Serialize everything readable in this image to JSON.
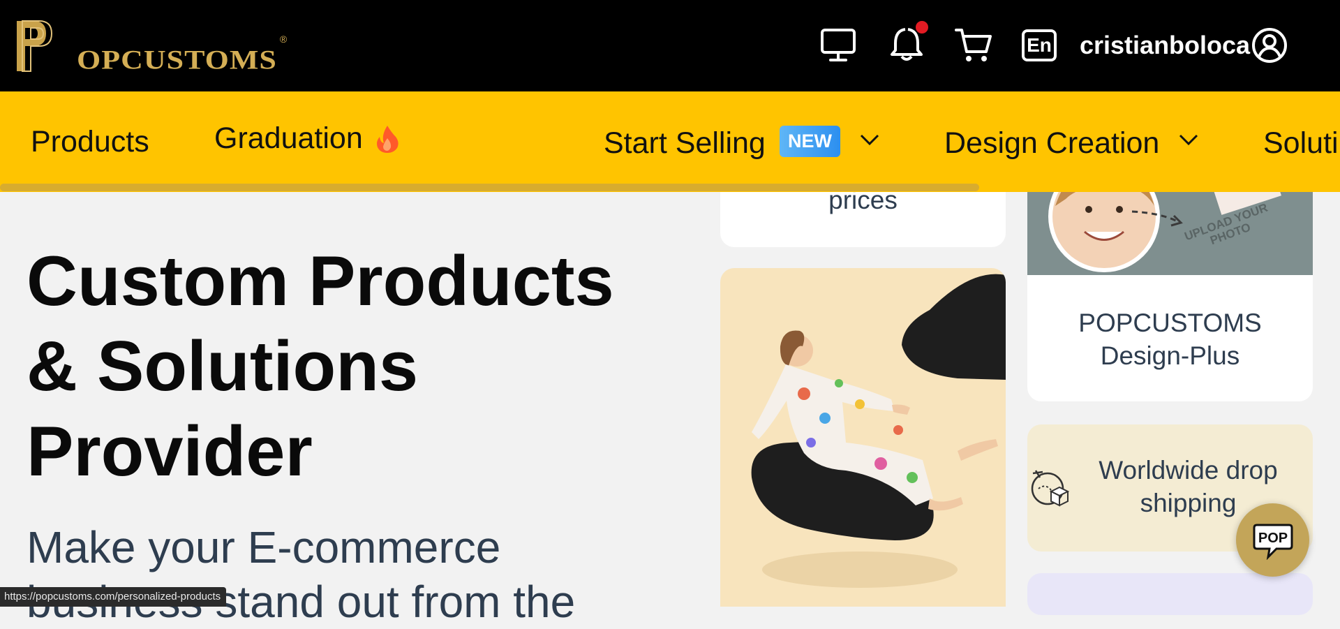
{
  "brand": {
    "logo_text": "OPCUSTOMS",
    "logo_mark": "PP",
    "registered": "®",
    "logo_color": "#d4ae55"
  },
  "header": {
    "icons": [
      "monitor-icon",
      "bell-icon",
      "cart-icon",
      "language-icon",
      "user-icon"
    ],
    "language": "En",
    "username": "cristianboloca",
    "notification_dot_color": "#e31b23"
  },
  "nav": {
    "items": [
      {
        "label": "Products"
      },
      {
        "label": "Graduation"
      },
      {
        "label": "Start Selling",
        "badge": "NEW"
      },
      {
        "label": "Design Creation"
      },
      {
        "label": "Soluti"
      }
    ],
    "background": "#ffc400"
  },
  "hero": {
    "title_line1": "Custom Products",
    "title_line2": "& Solutions",
    "title_line3": "Provider",
    "subtitle_line1": "Make your E-commerce",
    "subtitle_line2": "business stand out from the"
  },
  "cards": {
    "prices_text": "prices",
    "upload_caption": "UPLOAD YOUR PHOTO",
    "design_plus_line1": "POPCUSTOMS",
    "design_plus_line2": "Design-Plus",
    "dropship_line1": "Worldwide drop",
    "dropship_line2": "shipping"
  },
  "chat": {
    "label": "POP"
  },
  "status_url": "https://popcustoms.com/personalized-products"
}
